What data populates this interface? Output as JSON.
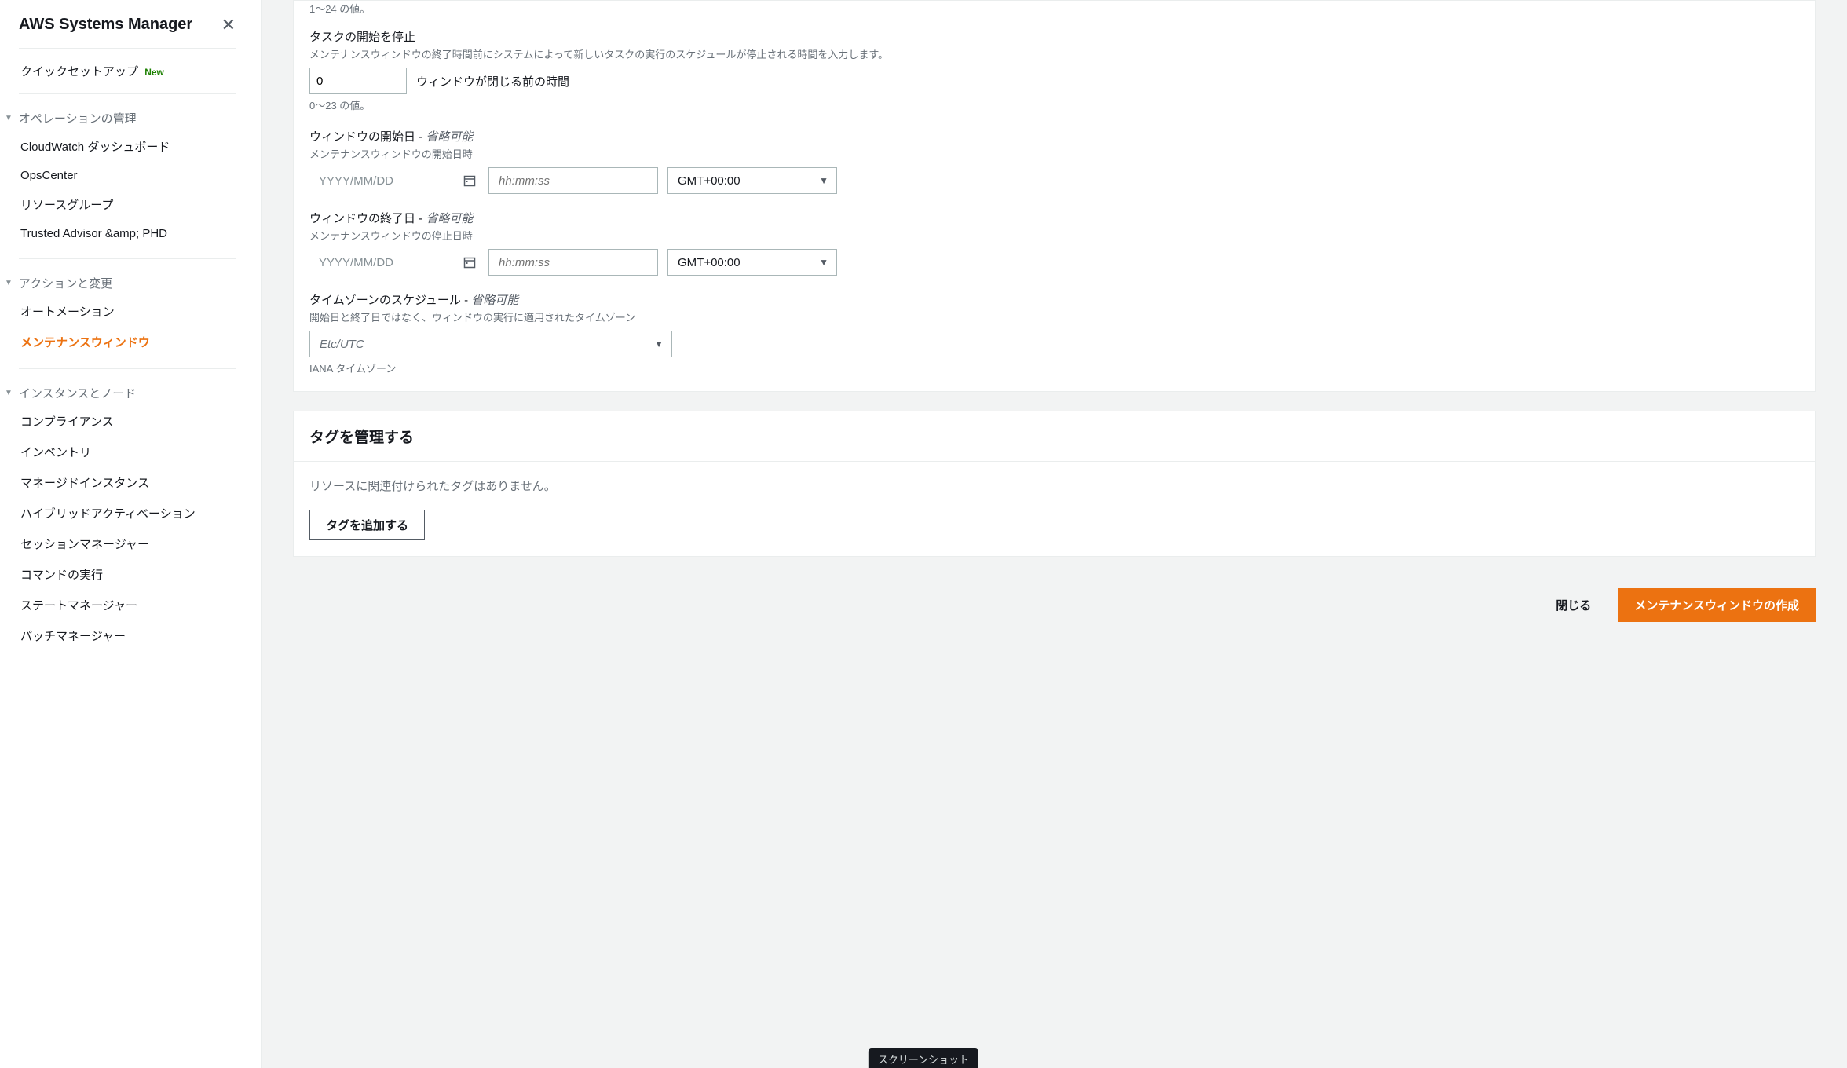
{
  "sidebar": {
    "title": "AWS Systems Manager",
    "quick_setup": "クイックセットアップ",
    "new_badge": "New",
    "section1": {
      "header": "オペレーションの管理",
      "items": [
        "CloudWatch ダッシュボード",
        "OpsCenter",
        "リソースグループ",
        "Trusted Advisor &amp; PHD"
      ]
    },
    "section2": {
      "header": "アクションと変更",
      "items": [
        "オートメーション",
        "メンテナンスウィンドウ"
      ]
    },
    "section3": {
      "header": "インスタンスとノード",
      "items": [
        "コンプライアンス",
        "インベントリ",
        "マネージドインスタンス",
        "ハイブリッドアクティベーション",
        "セッションマネージャー",
        "コマンドの実行",
        "ステートマネージャー",
        "パッチマネージャー"
      ]
    }
  },
  "form": {
    "top_hint": "1〜24 の値。",
    "stop_tasks": {
      "label": "タスクの開始を停止",
      "desc": "メンテナンスウィンドウの終了時間前にシステムによって新しいタスクの実行のスケジュールが停止される時間を入力します。",
      "value": "0",
      "after": "ウィンドウが閉じる前の時間",
      "hint": "0〜23 の値。"
    },
    "start_date": {
      "label": "ウィンドウの開始日 - ",
      "optional": "省略可能",
      "desc": "メンテナンスウィンドウの開始日時",
      "date_ph": "YYYY/MM/DD",
      "time_ph": "hh:mm:ss",
      "tz": "GMT+00:00"
    },
    "end_date": {
      "label": "ウィンドウの終了日 - ",
      "optional": "省略可能",
      "desc": "メンテナンスウィンドウの停止日時",
      "date_ph": "YYYY/MM/DD",
      "time_ph": "hh:mm:ss",
      "tz": "GMT+00:00"
    },
    "tz_schedule": {
      "label": "タイムゾーンのスケジュール - ",
      "optional": "省略可能",
      "desc": "開始日と終了日ではなく、ウィンドウの実行に適用されたタイムゾーン",
      "value": "Etc/UTC",
      "hint": "IANA タイムゾーン"
    }
  },
  "tags": {
    "title": "タグを管理する",
    "empty": "リソースに関連付けられたタグはありません。",
    "add": "タグを追加する"
  },
  "footer": {
    "cancel": "閉じる",
    "submit": "メンテナンスウィンドウの作成"
  },
  "tooltip": "スクリーンショット"
}
